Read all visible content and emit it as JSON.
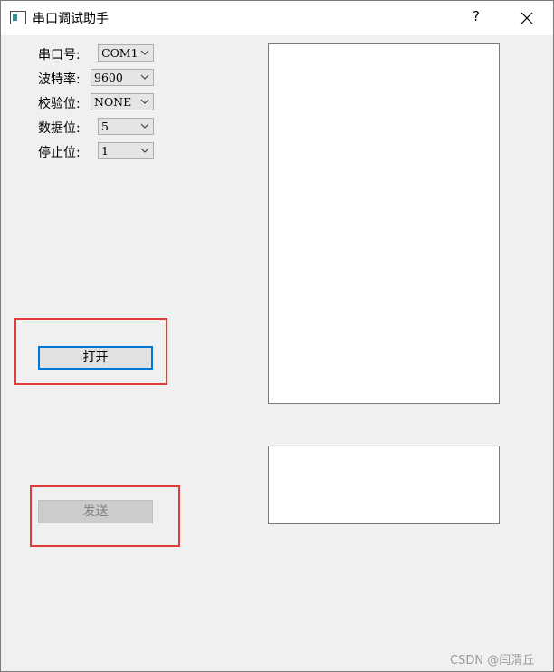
{
  "window": {
    "title": "串口调试助手",
    "help_label": "?"
  },
  "settings": [
    {
      "label": "串口号:",
      "value": "COM1"
    },
    {
      "label": "波特率:",
      "value": "9600"
    },
    {
      "label": "校验位:",
      "value": "NONE"
    },
    {
      "label": "数据位:",
      "value": "5"
    },
    {
      "label": "停止位:",
      "value": "1"
    }
  ],
  "buttons": {
    "open_label": "打开",
    "send_label": "发送"
  },
  "watermark": "CSDN @闫渭丘"
}
